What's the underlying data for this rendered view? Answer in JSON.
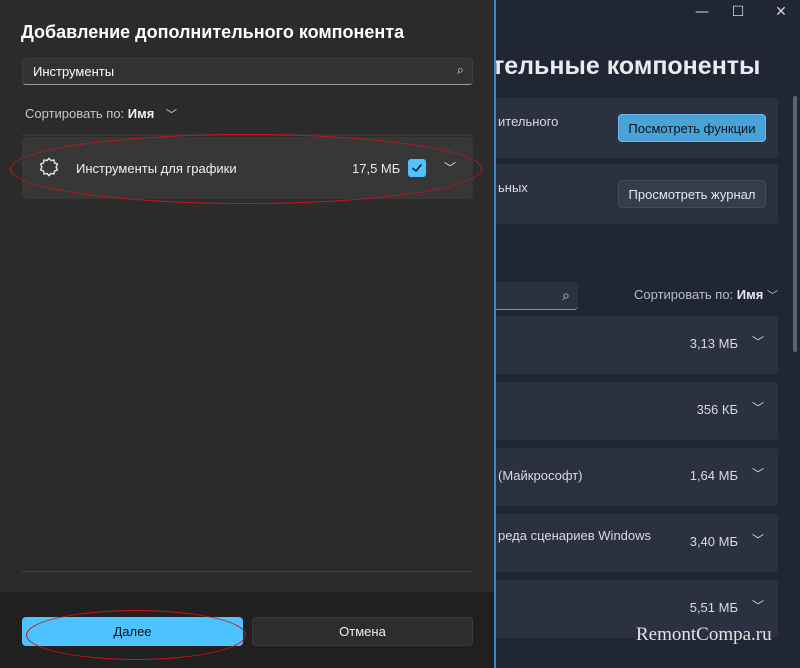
{
  "background_window": {
    "controls": {
      "minimize": "—",
      "maximize": "☐",
      "close": "✕"
    },
    "heading": "тельные компоненты",
    "cards": [
      {
        "text": "ительного",
        "button": "Посмотреть функции"
      },
      {
        "text": "ьных",
        "button": "Просмотреть журнал"
      }
    ],
    "sort_label": "Сортировать по:",
    "sort_value": "Имя",
    "rows": [
      {
        "name": "",
        "size": "3,13 МБ"
      },
      {
        "name": "",
        "size": "356 КБ"
      },
      {
        "name": "(Майкрософт)",
        "size": "1,64 МБ"
      },
      {
        "name": "реда сценариев Windows",
        "size": "3,40 МБ"
      },
      {
        "name": "",
        "size": "5,51 МБ"
      }
    ]
  },
  "dialog": {
    "title": "Добавление дополнительного компонента",
    "search": {
      "value": "Инструменты"
    },
    "sort": {
      "label": "Сортировать по:",
      "value": "Имя"
    },
    "features": [
      {
        "name": "Инструменты для графики",
        "size": "17,5 МБ",
        "checked": true
      }
    ],
    "buttons": {
      "next": "Далее",
      "cancel": "Отмена"
    }
  },
  "watermark": "RemontCompa.ru",
  "colors": {
    "accent": "#4cc2ff",
    "annotation": "#c8141c",
    "dialog_bg": "#2b2b2b"
  }
}
